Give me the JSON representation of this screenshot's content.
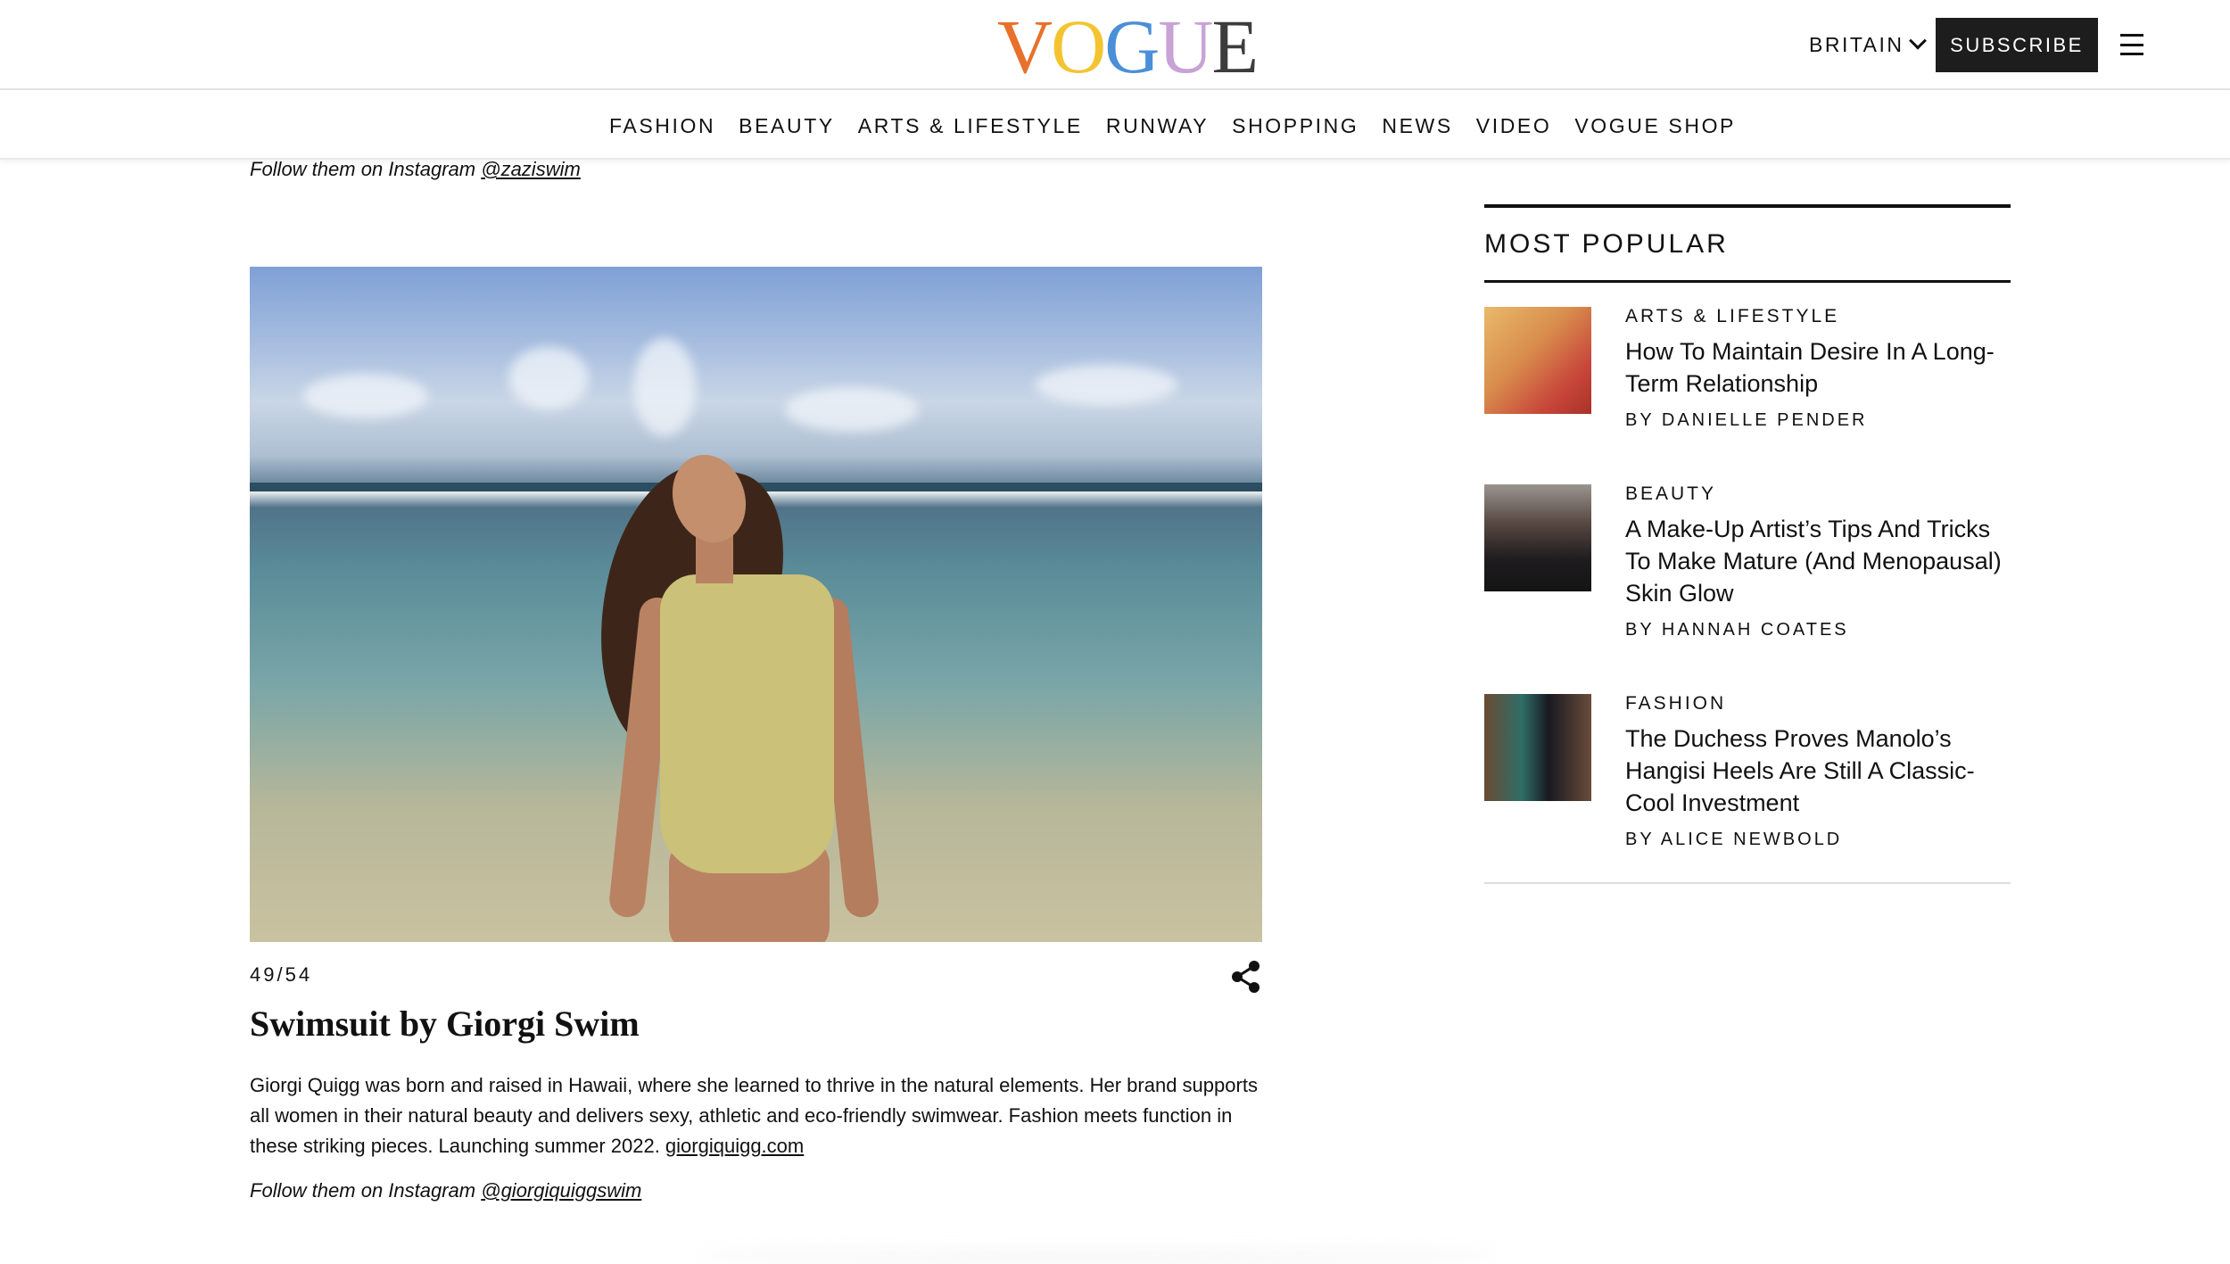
{
  "header": {
    "logo_letters": [
      {
        "char": "V",
        "color": "#e8702a"
      },
      {
        "char": "O",
        "color": "#f4c430"
      },
      {
        "char": "G",
        "color": "#4a8fd8"
      },
      {
        "char": "U",
        "color": "#c9a2d6"
      },
      {
        "char": "E",
        "color": "#3c3c3c"
      }
    ],
    "region_label": "BRITAIN",
    "subscribe_label": "SUBSCRIBE"
  },
  "nav": {
    "items": [
      "FASHION",
      "BEAUTY",
      "ARTS & LIFESTYLE",
      "RUNWAY",
      "SHOPPING",
      "NEWS",
      "VIDEO",
      "VOGUE SHOP"
    ]
  },
  "article": {
    "follow_top_prefix": "Follow them on Instagram ",
    "follow_top_handle": "@zaziswim",
    "counter": "49/54",
    "slide_title": "Swimsuit by Giorgi Swim",
    "slide_body": "Giorgi Quigg was born and raised in Hawaii, where she learned to thrive in the natural elements. Her brand supports all women in their natural beauty and delivers sexy, athletic and eco-friendly swimwear. Fashion meets function in these striking pieces. Launching summer 2022. ",
    "slide_link": "giorgiquigg.com",
    "follow_bottom_prefix": "Follow them on Instagram ",
    "follow_bottom_handle": "@giorgiquiggswim"
  },
  "sidebar": {
    "title": "MOST POPULAR",
    "items": [
      {
        "category": "ARTS & LIFESTYLE",
        "headline": "How To Maintain Desire In A Long-Term Relationship",
        "byline": "BY DANIELLE PENDER"
      },
      {
        "category": "BEAUTY",
        "headline": "A Make-Up Artist’s Tips And Tricks To Make Mature (And Menopausal) Skin Glow",
        "byline": "BY HANNAH COATES"
      },
      {
        "category": "FASHION",
        "headline": "The Duchess Proves Manolo’s Hangisi Heels Are Still A Classic-Cool Investment",
        "byline": "BY ALICE NEWBOLD"
      }
    ]
  }
}
